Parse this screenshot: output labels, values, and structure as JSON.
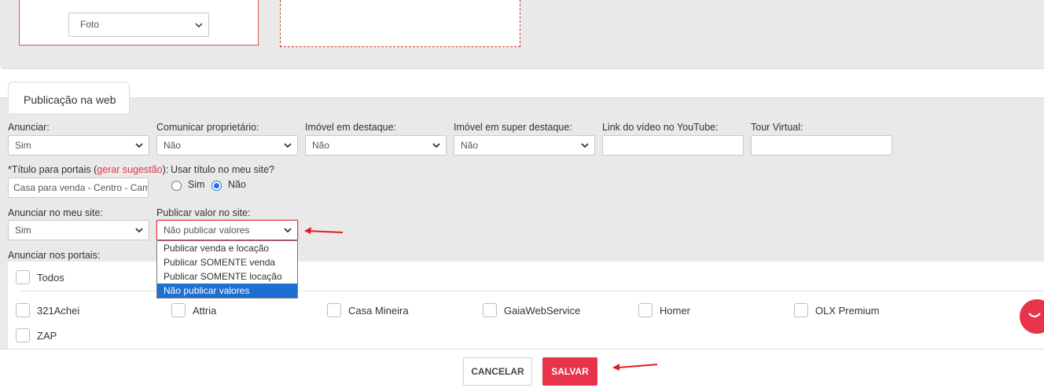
{
  "photo_section": {
    "select_value": "Foto"
  },
  "tab": {
    "label": "Publicação na web"
  },
  "fields": {
    "anunciar": {
      "label": "Anunciar:",
      "value": "Sim"
    },
    "comunicar": {
      "label": "Comunicar proprietário:",
      "value": "Não"
    },
    "destaque": {
      "label": "Imóvel em destaque:",
      "value": "Não"
    },
    "super_destaque": {
      "label": "Imóvel em super destaque:",
      "value": "Não"
    },
    "youtube": {
      "label": "Link do vídeo no YouTube:",
      "value": ""
    },
    "tour": {
      "label": "Tour Virtual:",
      "value": ""
    },
    "titulo": {
      "label_prefix": "*Título para portais (",
      "link": "gerar sugestão",
      "label_suffix": "):",
      "value": "Casa para venda - Centro - Camp"
    },
    "usar_titulo": {
      "label": "Usar título no meu site?",
      "option_yes": "Sim",
      "option_no": "Não",
      "selected": "Não"
    },
    "meu_site": {
      "label": "Anunciar no meu site:",
      "value": "Sim"
    },
    "publicar_valor": {
      "label": "Publicar valor no site:",
      "value": "Não publicar valores",
      "options": [
        "Publicar venda e locação",
        "Publicar SOMENTE venda",
        "Publicar SOMENTE locação",
        "Não publicar valores"
      ],
      "selected_index": 3
    }
  },
  "portals": {
    "label": "Anunciar nos portais:",
    "all_label": "Todos",
    "items": [
      "321Achei",
      "Attria",
      "Casa Mineira",
      "GaiaWebService",
      "Homer",
      "OLX Premium",
      "ZAP"
    ]
  },
  "footer": {
    "cancel_label": "CANCELAR",
    "save_label": "SALVAR"
  },
  "colors": {
    "accent": "#e8334a",
    "selection": "#1f6fd1",
    "panel_bg": "#e9e9e9"
  }
}
